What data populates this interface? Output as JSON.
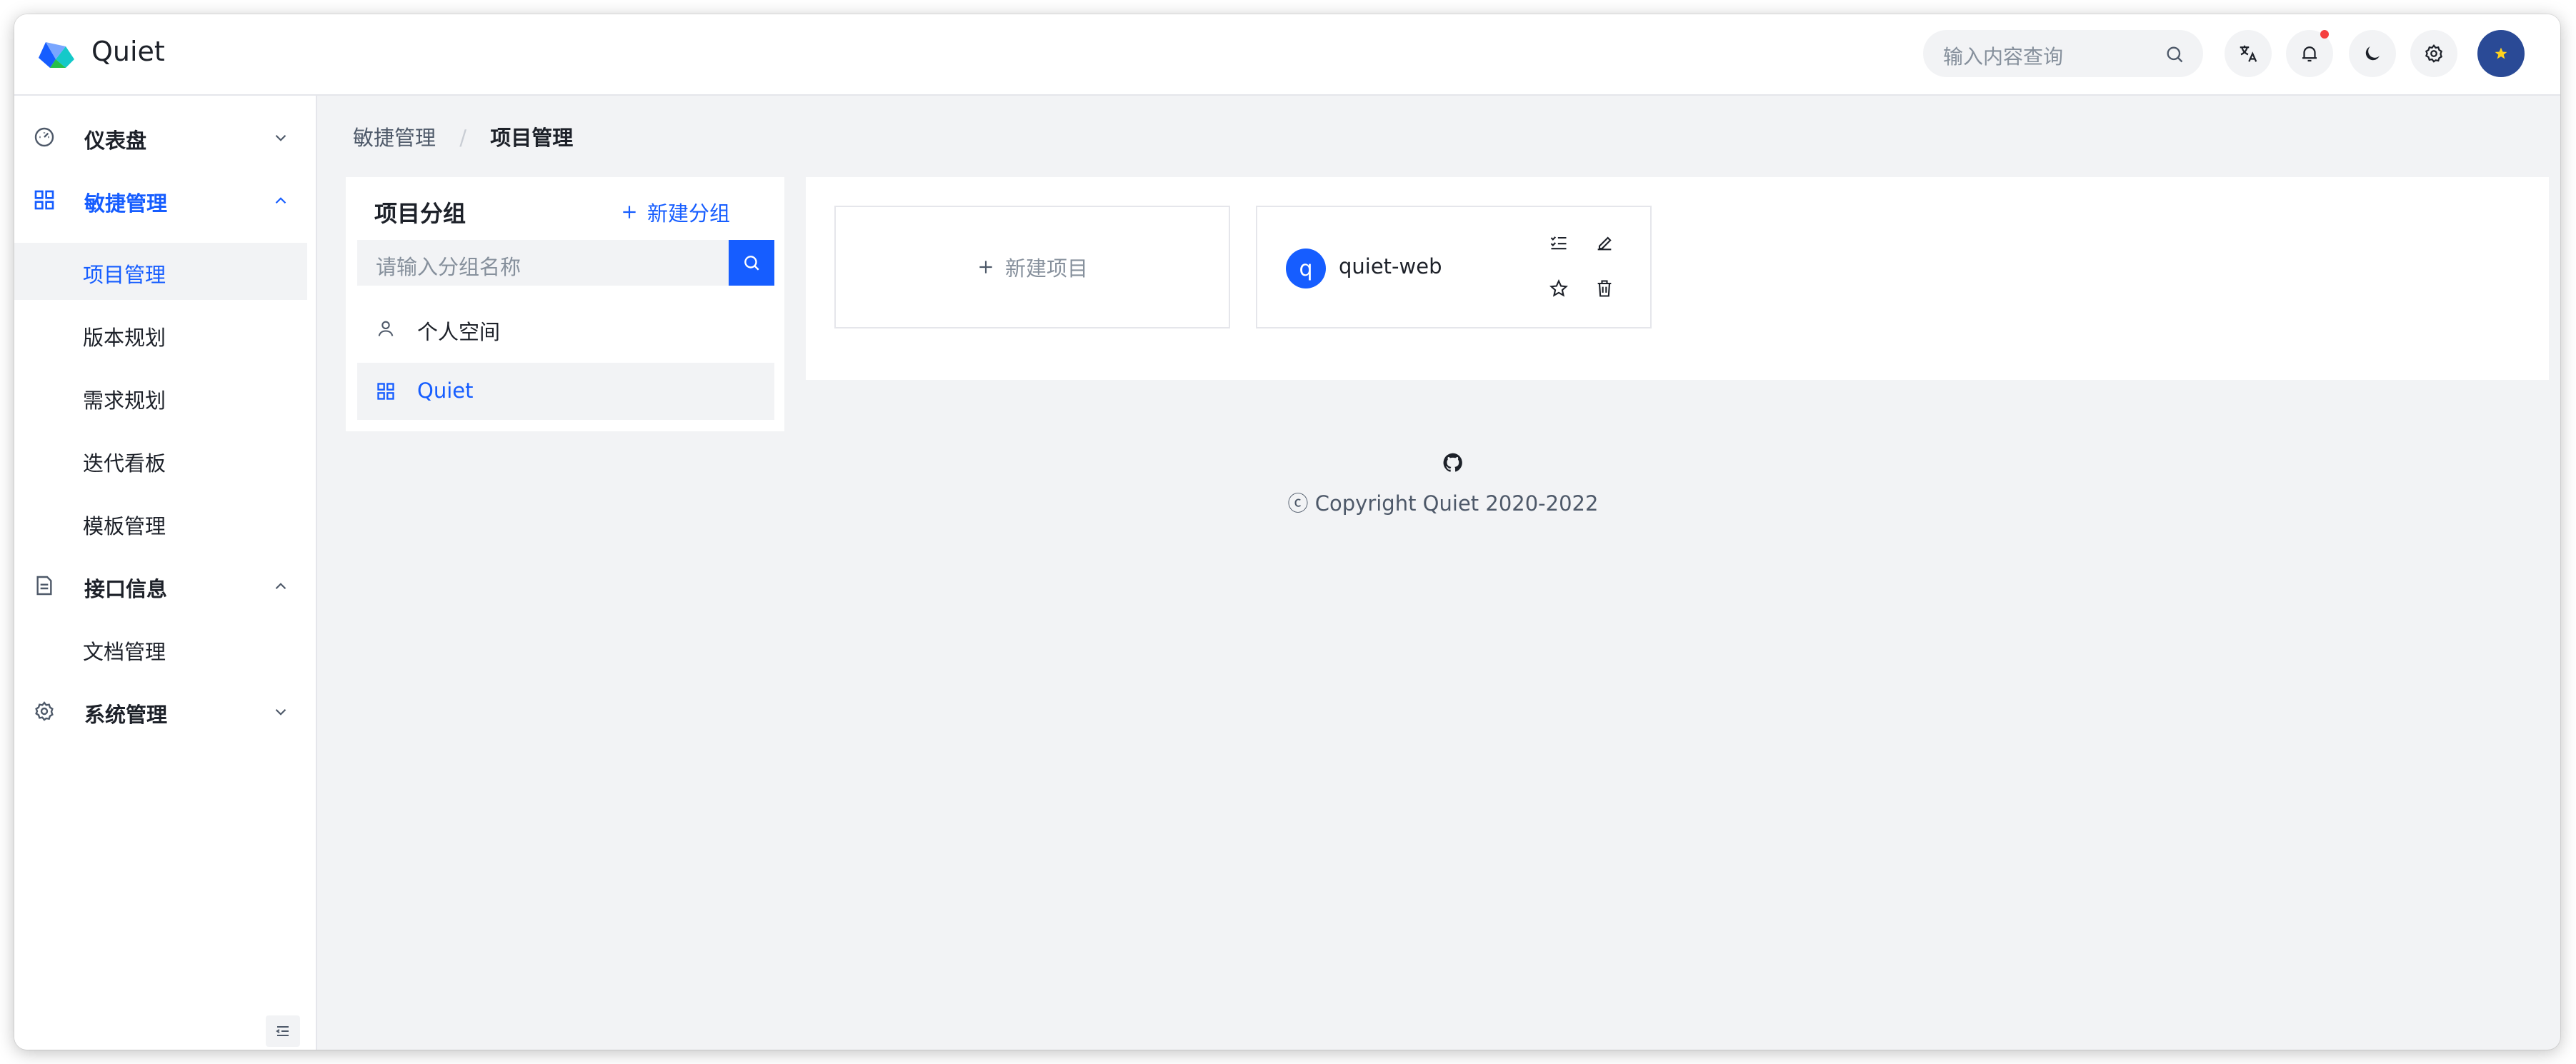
{
  "header": {
    "app_title": "Quiet",
    "search_placeholder": "输入内容查询",
    "icons": [
      "translate-icon",
      "bell-icon",
      "moon-icon",
      "gear-icon"
    ],
    "has_notification": true
  },
  "sidebar": {
    "menu": [
      {
        "label": "仪表盘",
        "icon": "dashboard-icon",
        "expanded": false
      },
      {
        "label": "敏捷管理",
        "icon": "apps-icon",
        "expanded": true,
        "active": true,
        "children": [
          "项目管理",
          "版本规划",
          "需求规划",
          "迭代看板",
          "模板管理"
        ]
      },
      {
        "label": "接口信息",
        "icon": "file-icon",
        "expanded": true,
        "children": [
          "文档管理"
        ]
      },
      {
        "label": "系统管理",
        "icon": "settings-icon",
        "expanded": false
      }
    ],
    "selected_child": "项目管理"
  },
  "breadcrumb": {
    "parent": "敏捷管理",
    "separator": "/",
    "current": "项目管理"
  },
  "group_panel": {
    "title": "项目分组",
    "new_group_label": "新建分组",
    "search_placeholder": "请输入分组名称",
    "items": [
      {
        "label": "个人空间",
        "icon": "user-icon",
        "selected": false
      },
      {
        "label": "Quiet",
        "icon": "apps-icon",
        "selected": true
      }
    ]
  },
  "projects": {
    "new_project_label": "新建项目",
    "items": [
      {
        "avatar_letter": "q",
        "name": "quiet-web"
      }
    ]
  },
  "footer": {
    "copyright": "ⓒ Copyright Quiet 2020-2022"
  },
  "colors": {
    "primary": "#165dff",
    "background": "#f2f3f5",
    "text": "#1d2129",
    "notification": "#f53f3f"
  }
}
